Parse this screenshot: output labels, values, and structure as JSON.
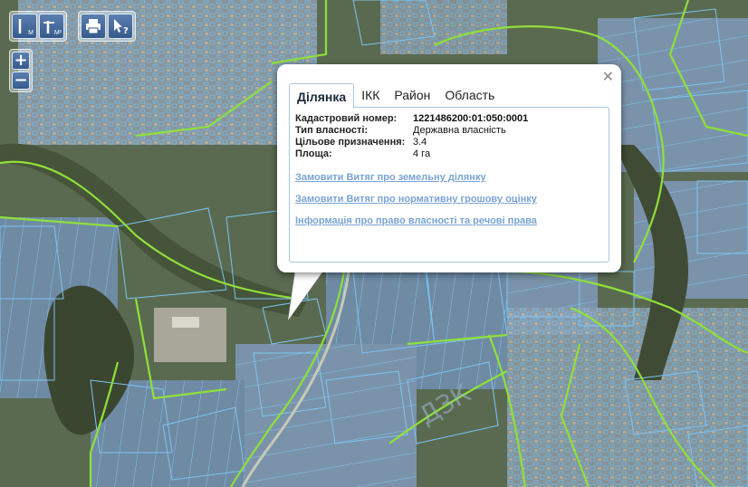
{
  "toolbar": {
    "ruler_m_label": "M",
    "ruler_m2_label": "M²",
    "icons": [
      "ruler-icon",
      "area-ruler-icon",
      "print-icon",
      "info-cursor-icon"
    ]
  },
  "zoom": {
    "in_label": "+",
    "out_label": "−"
  },
  "popup": {
    "close_label": "✕",
    "tabs": [
      "Ділянка",
      "ІКК",
      "Район",
      "Область"
    ],
    "active_tab": "Ділянка",
    "fields": [
      {
        "label": "Кадастровий номер:",
        "value": "1221486200:01:050:0001"
      },
      {
        "label": "Тип власності:",
        "value": "Державна власність"
      },
      {
        "label": "Цільове призначення:",
        "value": "3.4"
      },
      {
        "label": "Площа:",
        "value": "4 га"
      }
    ],
    "links": [
      "Замовити Витяг про земельну ділянку",
      "Замовити Витяг про нормативну грошову оцінку",
      "Інформація про право власності та речові права"
    ]
  },
  "map": {
    "watermark": "ДЗК",
    "colors": {
      "parcel_outline": "#78c0f0",
      "boundary": "#8fe03a",
      "imagery": "#5e6b55"
    }
  }
}
